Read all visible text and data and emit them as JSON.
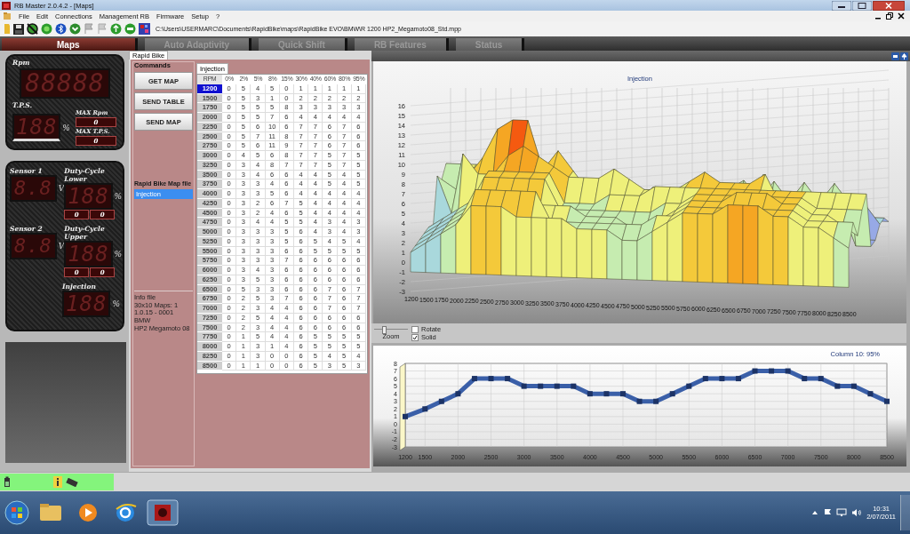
{
  "window": {
    "title": "RB Master  2.0.4.2 - [Maps]"
  },
  "menu": [
    "File",
    "Edit",
    "Connections",
    "Management RB",
    "Firmware",
    "Setup",
    "?"
  ],
  "toolbar": {
    "path": "C:\\Users\\USERMARC\\Documents\\RapidBike\\maps\\RapidBike EVO\\BMW\\R 1200 HP2_Megamoto08_Std.mpp"
  },
  "main_tabs": [
    {
      "label": "Maps",
      "selected": true,
      "disabled": false
    },
    {
      "label": "Auto Adaptivity",
      "selected": false,
      "disabled": true
    },
    {
      "label": "Quick Shift",
      "selected": false,
      "disabled": true
    },
    {
      "label": "RB Features",
      "selected": false,
      "disabled": true
    },
    {
      "label": "Status",
      "selected": false,
      "disabled": true
    }
  ],
  "gauges": {
    "rpm": {
      "label": "Rpm",
      "display": "88888"
    },
    "tps": {
      "label": "T.P.S.",
      "display": "188",
      "unit": "%"
    },
    "max": [
      {
        "label": "MAX Rpm",
        "value": "0"
      },
      {
        "label": "MAX T.P.S.",
        "value": "0"
      }
    ],
    "sensors": [
      {
        "label": "Sensor 1",
        "display": "8.8",
        "unit": "V"
      },
      {
        "label": "Sensor 2",
        "display": "8.8",
        "unit": "V"
      }
    ],
    "duty": [
      {
        "label": "Duty-Cycle Lower",
        "display": "188",
        "unit": "%",
        "values": [
          "0",
          "0"
        ]
      },
      {
        "label": "Duty-Cycle Upper",
        "display": "188",
        "unit": "%",
        "values": [
          "0",
          "0"
        ]
      }
    ],
    "injection": {
      "label": "Injection",
      "display": "188",
      "unit": "%"
    }
  },
  "sub_tab": {
    "label": "Rapid Bike",
    "selected": true
  },
  "commands": {
    "title": "Commands",
    "buttons": [
      "GET MAP",
      "SEND TABLE",
      "SEND MAP"
    ],
    "map_file_title": "Rapid Bike Map file",
    "map_files": [
      {
        "label": "Injection",
        "selected": true
      }
    ],
    "info": [
      "Info file",
      "30x10 Maps: 1",
      "1.0.15 - 0001",
      "BMW",
      "HP2 Megamoto 08"
    ]
  },
  "table": {
    "tab": {
      "label": "Injection",
      "selected": true
    },
    "columns": [
      "RPM",
      "0%",
      "2%",
      "5%",
      "8%",
      "15%",
      "30%",
      "40%",
      "60%",
      "80%",
      "95%"
    ],
    "rows": [
      {
        "selected": true,
        "cells": [
          "1200",
          "0",
          "5",
          "4",
          "5",
          "0",
          "1",
          "1",
          "1",
          "1",
          "1"
        ]
      },
      {
        "selected": false,
        "cells": [
          "1500",
          "0",
          "5",
          "3",
          "1",
          "0",
          "2",
          "2",
          "2",
          "2",
          "2"
        ]
      },
      {
        "selected": false,
        "cells": [
          "1750",
          "0",
          "5",
          "5",
          "5",
          "8",
          "3",
          "3",
          "3",
          "3",
          "3"
        ]
      },
      {
        "selected": false,
        "cells": [
          "2000",
          "0",
          "5",
          "5",
          "7",
          "6",
          "4",
          "4",
          "4",
          "4",
          "4"
        ]
      },
      {
        "selected": false,
        "cells": [
          "2250",
          "0",
          "5",
          "6",
          "10",
          "6",
          "7",
          "7",
          "6",
          "7",
          "6"
        ]
      },
      {
        "selected": false,
        "cells": [
          "2500",
          "0",
          "5",
          "7",
          "11",
          "8",
          "7",
          "7",
          "6",
          "7",
          "6"
        ]
      },
      {
        "selected": false,
        "cells": [
          "2750",
          "0",
          "5",
          "6",
          "11",
          "9",
          "7",
          "7",
          "6",
          "7",
          "6"
        ]
      },
      {
        "selected": false,
        "cells": [
          "3000",
          "0",
          "4",
          "5",
          "6",
          "8",
          "7",
          "7",
          "5",
          "7",
          "5"
        ]
      },
      {
        "selected": false,
        "cells": [
          "3250",
          "0",
          "3",
          "4",
          "8",
          "7",
          "7",
          "7",
          "5",
          "7",
          "5"
        ]
      },
      {
        "selected": false,
        "cells": [
          "3500",
          "0",
          "3",
          "4",
          "6",
          "6",
          "4",
          "4",
          "5",
          "4",
          "5"
        ]
      },
      {
        "selected": false,
        "cells": [
          "3750",
          "0",
          "3",
          "3",
          "4",
          "6",
          "4",
          "4",
          "5",
          "4",
          "5"
        ]
      },
      {
        "selected": false,
        "cells": [
          "4000",
          "0",
          "3",
          "3",
          "5",
          "6",
          "4",
          "4",
          "4",
          "4",
          "4"
        ]
      },
      {
        "selected": false,
        "cells": [
          "4250",
          "0",
          "3",
          "2",
          "6",
          "7",
          "5",
          "4",
          "4",
          "4",
          "4"
        ]
      },
      {
        "selected": false,
        "cells": [
          "4500",
          "0",
          "3",
          "2",
          "4",
          "6",
          "5",
          "4",
          "4",
          "4",
          "4"
        ]
      },
      {
        "selected": false,
        "cells": [
          "4750",
          "0",
          "3",
          "4",
          "4",
          "5",
          "5",
          "4",
          "3",
          "4",
          "3"
        ]
      },
      {
        "selected": false,
        "cells": [
          "5000",
          "0",
          "3",
          "3",
          "3",
          "5",
          "6",
          "4",
          "3",
          "4",
          "3"
        ]
      },
      {
        "selected": false,
        "cells": [
          "5250",
          "0",
          "3",
          "3",
          "3",
          "5",
          "6",
          "5",
          "4",
          "5",
          "4"
        ]
      },
      {
        "selected": false,
        "cells": [
          "5500",
          "0",
          "3",
          "3",
          "3",
          "6",
          "6",
          "5",
          "5",
          "5",
          "5"
        ]
      },
      {
        "selected": false,
        "cells": [
          "5750",
          "0",
          "3",
          "3",
          "3",
          "7",
          "6",
          "6",
          "6",
          "6",
          "6"
        ]
      },
      {
        "selected": false,
        "cells": [
          "6000",
          "0",
          "3",
          "4",
          "3",
          "6",
          "6",
          "6",
          "6",
          "6",
          "6"
        ]
      },
      {
        "selected": false,
        "cells": [
          "6250",
          "0",
          "3",
          "5",
          "3",
          "6",
          "6",
          "6",
          "6",
          "6",
          "6"
        ]
      },
      {
        "selected": false,
        "cells": [
          "6500",
          "0",
          "5",
          "3",
          "3",
          "6",
          "6",
          "6",
          "7",
          "6",
          "7"
        ]
      },
      {
        "selected": false,
        "cells": [
          "6750",
          "0",
          "2",
          "5",
          "3",
          "7",
          "6",
          "6",
          "7",
          "6",
          "7"
        ]
      },
      {
        "selected": false,
        "cells": [
          "7000",
          "0",
          "2",
          "3",
          "4",
          "4",
          "6",
          "6",
          "7",
          "6",
          "7"
        ]
      },
      {
        "selected": false,
        "cells": [
          "7250",
          "0",
          "2",
          "5",
          "4",
          "4",
          "6",
          "6",
          "6",
          "6",
          "6"
        ]
      },
      {
        "selected": false,
        "cells": [
          "7500",
          "0",
          "2",
          "3",
          "4",
          "4",
          "6",
          "6",
          "6",
          "6",
          "6"
        ]
      },
      {
        "selected": false,
        "cells": [
          "7750",
          "0",
          "1",
          "5",
          "4",
          "4",
          "6",
          "5",
          "5",
          "5",
          "5"
        ]
      },
      {
        "selected": false,
        "cells": [
          "8000",
          "0",
          "1",
          "3",
          "1",
          "4",
          "6",
          "5",
          "5",
          "5",
          "5"
        ]
      },
      {
        "selected": false,
        "cells": [
          "8250",
          "0",
          "1",
          "3",
          "0",
          "0",
          "6",
          "5",
          "4",
          "5",
          "4"
        ]
      },
      {
        "selected": false,
        "cells": [
          "8500",
          "0",
          "1",
          "1",
          "0",
          "0",
          "6",
          "5",
          "3",
          "5",
          "3"
        ]
      }
    ]
  },
  "surface_chart": {
    "title": "Injection",
    "y_labels": [
      "16",
      "15",
      "14",
      "13",
      "12",
      "11",
      "10",
      "9",
      "8",
      "7",
      "6",
      "5",
      "4",
      "3",
      "2",
      "1",
      "0",
      "-1",
      "-2",
      "-3"
    ],
    "x_labels": [
      "1200",
      "1500",
      "1750",
      "2000",
      "2250",
      "2500",
      "2750",
      "3000",
      "3250",
      "3500",
      "3750",
      "4000",
      "4250",
      "4500",
      "4750",
      "5000",
      "5250",
      "5500",
      "5750",
      "6000",
      "6250",
      "6500",
      "6750",
      "7000",
      "7250",
      "7500",
      "7750",
      "8000",
      "8250",
      "8500"
    ]
  },
  "view_controls": {
    "zoom": {
      "label": "Zoom",
      "level": 0.3
    },
    "checkboxes": [
      {
        "label": "Rotate",
        "checked": false
      },
      {
        "label": "Solid",
        "checked": true
      }
    ]
  },
  "line_chart": {
    "chart_data": {
      "type": "line",
      "title": "Column 10: 95%",
      "grid": true,
      "marker": "square",
      "x": [
        1200,
        1500,
        1750,
        2000,
        2250,
        2500,
        2750,
        3000,
        3250,
        3500,
        3750,
        4000,
        4250,
        4500,
        4750,
        5000,
        5250,
        5500,
        5750,
        6000,
        6250,
        6500,
        6750,
        7000,
        7250,
        7500,
        7750,
        8000,
        8250,
        8500
      ],
      "values": [
        1,
        2,
        3,
        4,
        6,
        6,
        6,
        5,
        5,
        5,
        5,
        4,
        4,
        4,
        3,
        3,
        4,
        5,
        6,
        6,
        6,
        7,
        7,
        7,
        6,
        6,
        5,
        5,
        4,
        3
      ],
      "xlim": [
        1200,
        8500
      ],
      "ylim": [
        -3,
        8
      ],
      "xticks": [
        1200,
        1500,
        2000,
        2500,
        3000,
        3500,
        4000,
        4500,
        5000,
        5500,
        6000,
        6500,
        7000,
        7500,
        8000,
        8500
      ],
      "yticks": [
        -3,
        -2,
        -1,
        0,
        1,
        2,
        3,
        4,
        5,
        6,
        7,
        8
      ]
    }
  },
  "taskbar": {
    "time": "10:31",
    "date": "2/07/2011"
  }
}
